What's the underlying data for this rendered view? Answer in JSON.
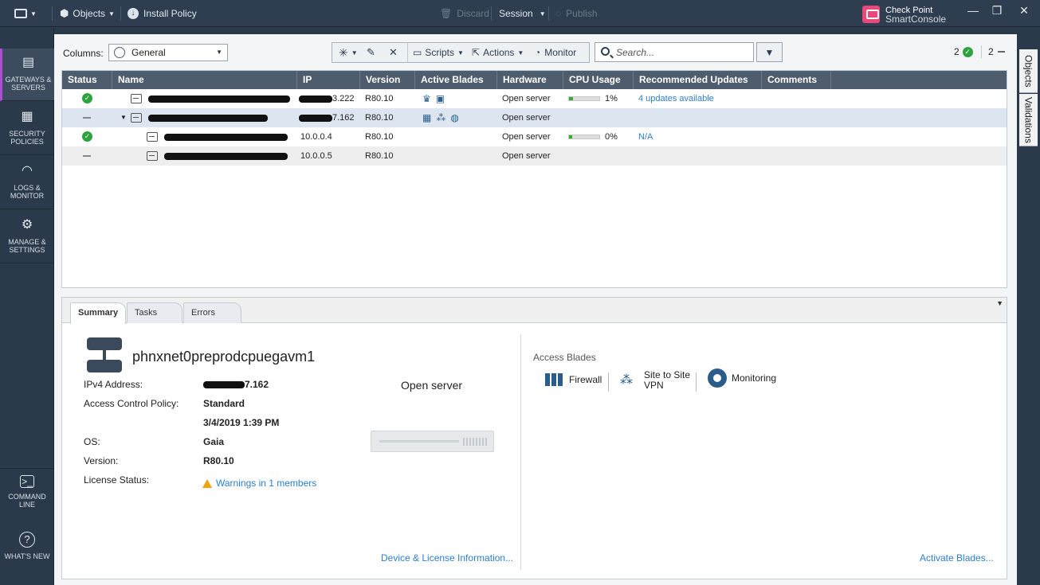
{
  "topbar": {
    "objects": "Objects",
    "install_policy": "Install Policy",
    "discard": "Discard",
    "session": "Session",
    "publish": "Publish",
    "brand_line1": "Check Point",
    "brand_line2": "SmartConsole"
  },
  "leftnav": {
    "items": [
      {
        "label": "GATEWAYS & SERVERS",
        "icon": "gateways-icon"
      },
      {
        "label": "SECURITY POLICIES",
        "icon": "policies-icon"
      },
      {
        "label": "LOGS & MONITOR",
        "icon": "gauge-icon"
      },
      {
        "label": "MANAGE & SETTINGS",
        "icon": "gear-icon"
      },
      {
        "label": "COMMAND LINE",
        "icon": "terminal-icon"
      },
      {
        "label": "WHAT'S NEW",
        "icon": "question-icon"
      }
    ]
  },
  "rightrail": {
    "objects": "Objects",
    "validations": "Validations"
  },
  "toolbar": {
    "columns_label": "Columns:",
    "columns_value": "General",
    "scripts": "Scripts",
    "actions": "Actions",
    "monitor": "Monitor",
    "search_placeholder": "Search...",
    "count_ok": "2",
    "count_other": "2"
  },
  "grid": {
    "columns": [
      "Status",
      "Name",
      "IP",
      "Version",
      "Active Blades",
      "Hardware",
      "CPU Usage",
      "Recommended Updates",
      "Comments"
    ],
    "rows": [
      {
        "status": "ok",
        "ip_suffix": "3.222",
        "version": "R80.10",
        "hardware": "Open server",
        "cpu": "1%",
        "cpu_value": 0.12,
        "updates": "4 updates available"
      },
      {
        "status": "none",
        "ip_suffix": "7.162",
        "version": "R80.10",
        "hardware": "Open server",
        "cpu": "",
        "cpu_value": 0,
        "updates": ""
      },
      {
        "status": "ok",
        "ip": "10.0.0.4",
        "version": "R80.10",
        "hardware": "Open server",
        "cpu": "0%",
        "cpu_value": 0.1,
        "updates": "N/A"
      },
      {
        "status": "none",
        "ip": "10.0.0.5",
        "version": "R80.10",
        "hardware": "Open server",
        "cpu": "",
        "cpu_value": 0,
        "updates": ""
      }
    ]
  },
  "detail": {
    "tabs": [
      "Summary",
      "Tasks",
      "Errors"
    ],
    "name": "phnxnet0preprodcpuegavm1",
    "ipv4_label": "IPv4 Address:",
    "ipv4_suffix": "7.162",
    "acp_label": "Access Control Policy:",
    "acp_value": "Standard",
    "acp_date": "3/4/2019 1:39 PM",
    "os_label": "OS:",
    "os_value": "Gaia",
    "version_label": "Version:",
    "version_value": "R80.10",
    "license_label": "License Status:",
    "license_value": "Warnings in 1 members",
    "hardware": "Open server",
    "access_blades_title": "Access Blades",
    "blade_firewall": "Firewall",
    "blade_vpn_1": "Site to Site",
    "blade_vpn_2": "VPN",
    "blade_monitoring": "Monitoring",
    "device_link": "Device & License Information...",
    "activate_link": "Activate Blades..."
  }
}
